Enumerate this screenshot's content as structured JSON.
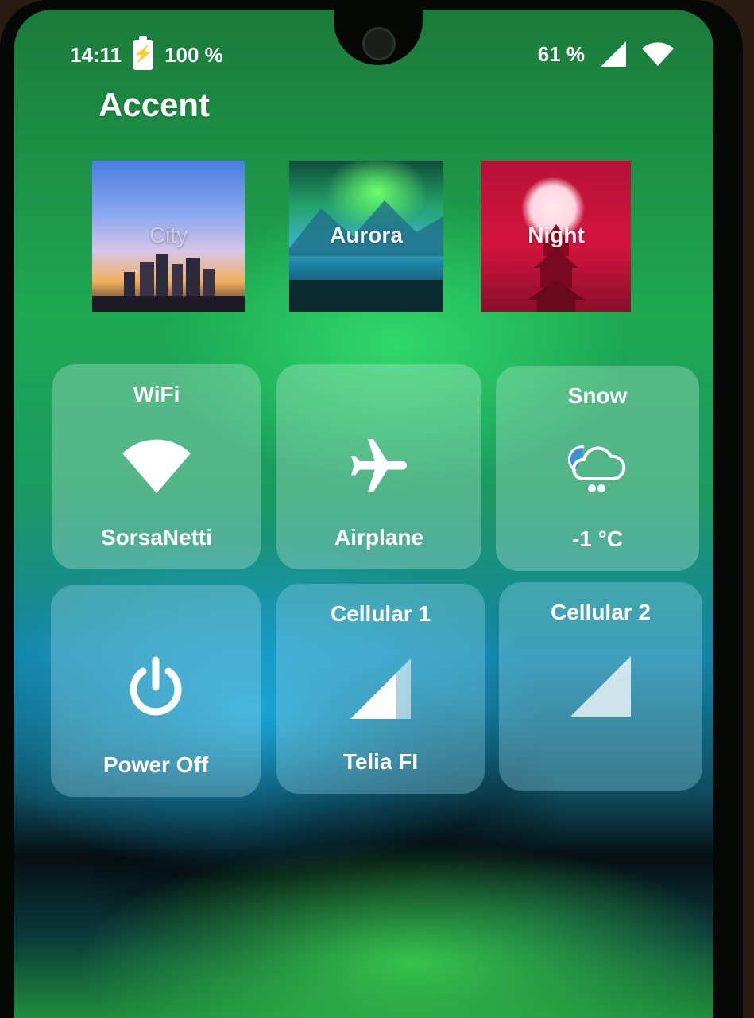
{
  "status_bar": {
    "time": "14:11",
    "battery_percent": "100 %",
    "signal_percent": "61 %"
  },
  "header": {
    "title": "Accent"
  },
  "themes": [
    {
      "label": "City"
    },
    {
      "label": "Aurora"
    },
    {
      "label": "Night"
    }
  ],
  "tiles": {
    "wifi": {
      "title": "WiFi",
      "subtitle": "SorsaNetti",
      "icon": "wifi-icon"
    },
    "airplane": {
      "subtitle": "Airplane",
      "icon": "airplane-icon"
    },
    "weather": {
      "title": "Snow",
      "subtitle": "-1 °C",
      "icon": "snow-cloud-icon"
    },
    "power": {
      "subtitle": "Power Off",
      "icon": "power-icon"
    },
    "cellular1": {
      "title": "Cellular 1",
      "subtitle": "Telia FI",
      "icon": "cell-signal-icon"
    },
    "cellular2": {
      "title": "Cellular 2",
      "icon": "cell-signal-icon"
    }
  },
  "colors": {
    "accent": "#1ea852",
    "night_red": "#d4143e",
    "tile_bg": "#c8ebe1"
  }
}
